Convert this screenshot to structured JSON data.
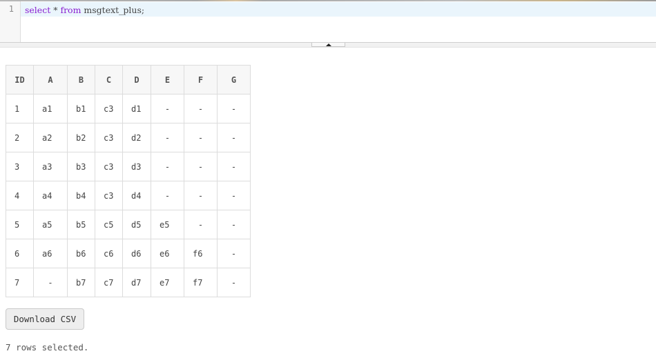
{
  "editor": {
    "line_number": "1",
    "code": {
      "kw1": "select",
      "rest1": " * ",
      "kw2": "from",
      "rest2": " msgtext_plus;"
    }
  },
  "results": {
    "columns": [
      "ID",
      "A",
      "B",
      "C",
      "D",
      "E",
      "F",
      "G"
    ],
    "rows": [
      [
        "1",
        "a1",
        "b1",
        "c3",
        "d1",
        "-",
        "-",
        "-"
      ],
      [
        "2",
        "a2",
        "b2",
        "c3",
        "d2",
        "-",
        "-",
        "-"
      ],
      [
        "3",
        "a3",
        "b3",
        "c3",
        "d3",
        "-",
        "-",
        "-"
      ],
      [
        "4",
        "a4",
        "b4",
        "c3",
        "d4",
        "-",
        "-",
        "-"
      ],
      [
        "5",
        "a5",
        "b5",
        "c5",
        "d5",
        "e5",
        "-",
        "-"
      ],
      [
        "6",
        "a6",
        "b6",
        "c6",
        "d6",
        "e6",
        "f6",
        "-"
      ],
      [
        "7",
        "-",
        "b7",
        "c7",
        "d7",
        "e7",
        "f7",
        "-"
      ]
    ]
  },
  "download_button": {
    "label": "Download CSV"
  },
  "status": {
    "text": "7 rows selected."
  },
  "icons": {
    "splitter": "collapse-up-arrow-icon"
  }
}
